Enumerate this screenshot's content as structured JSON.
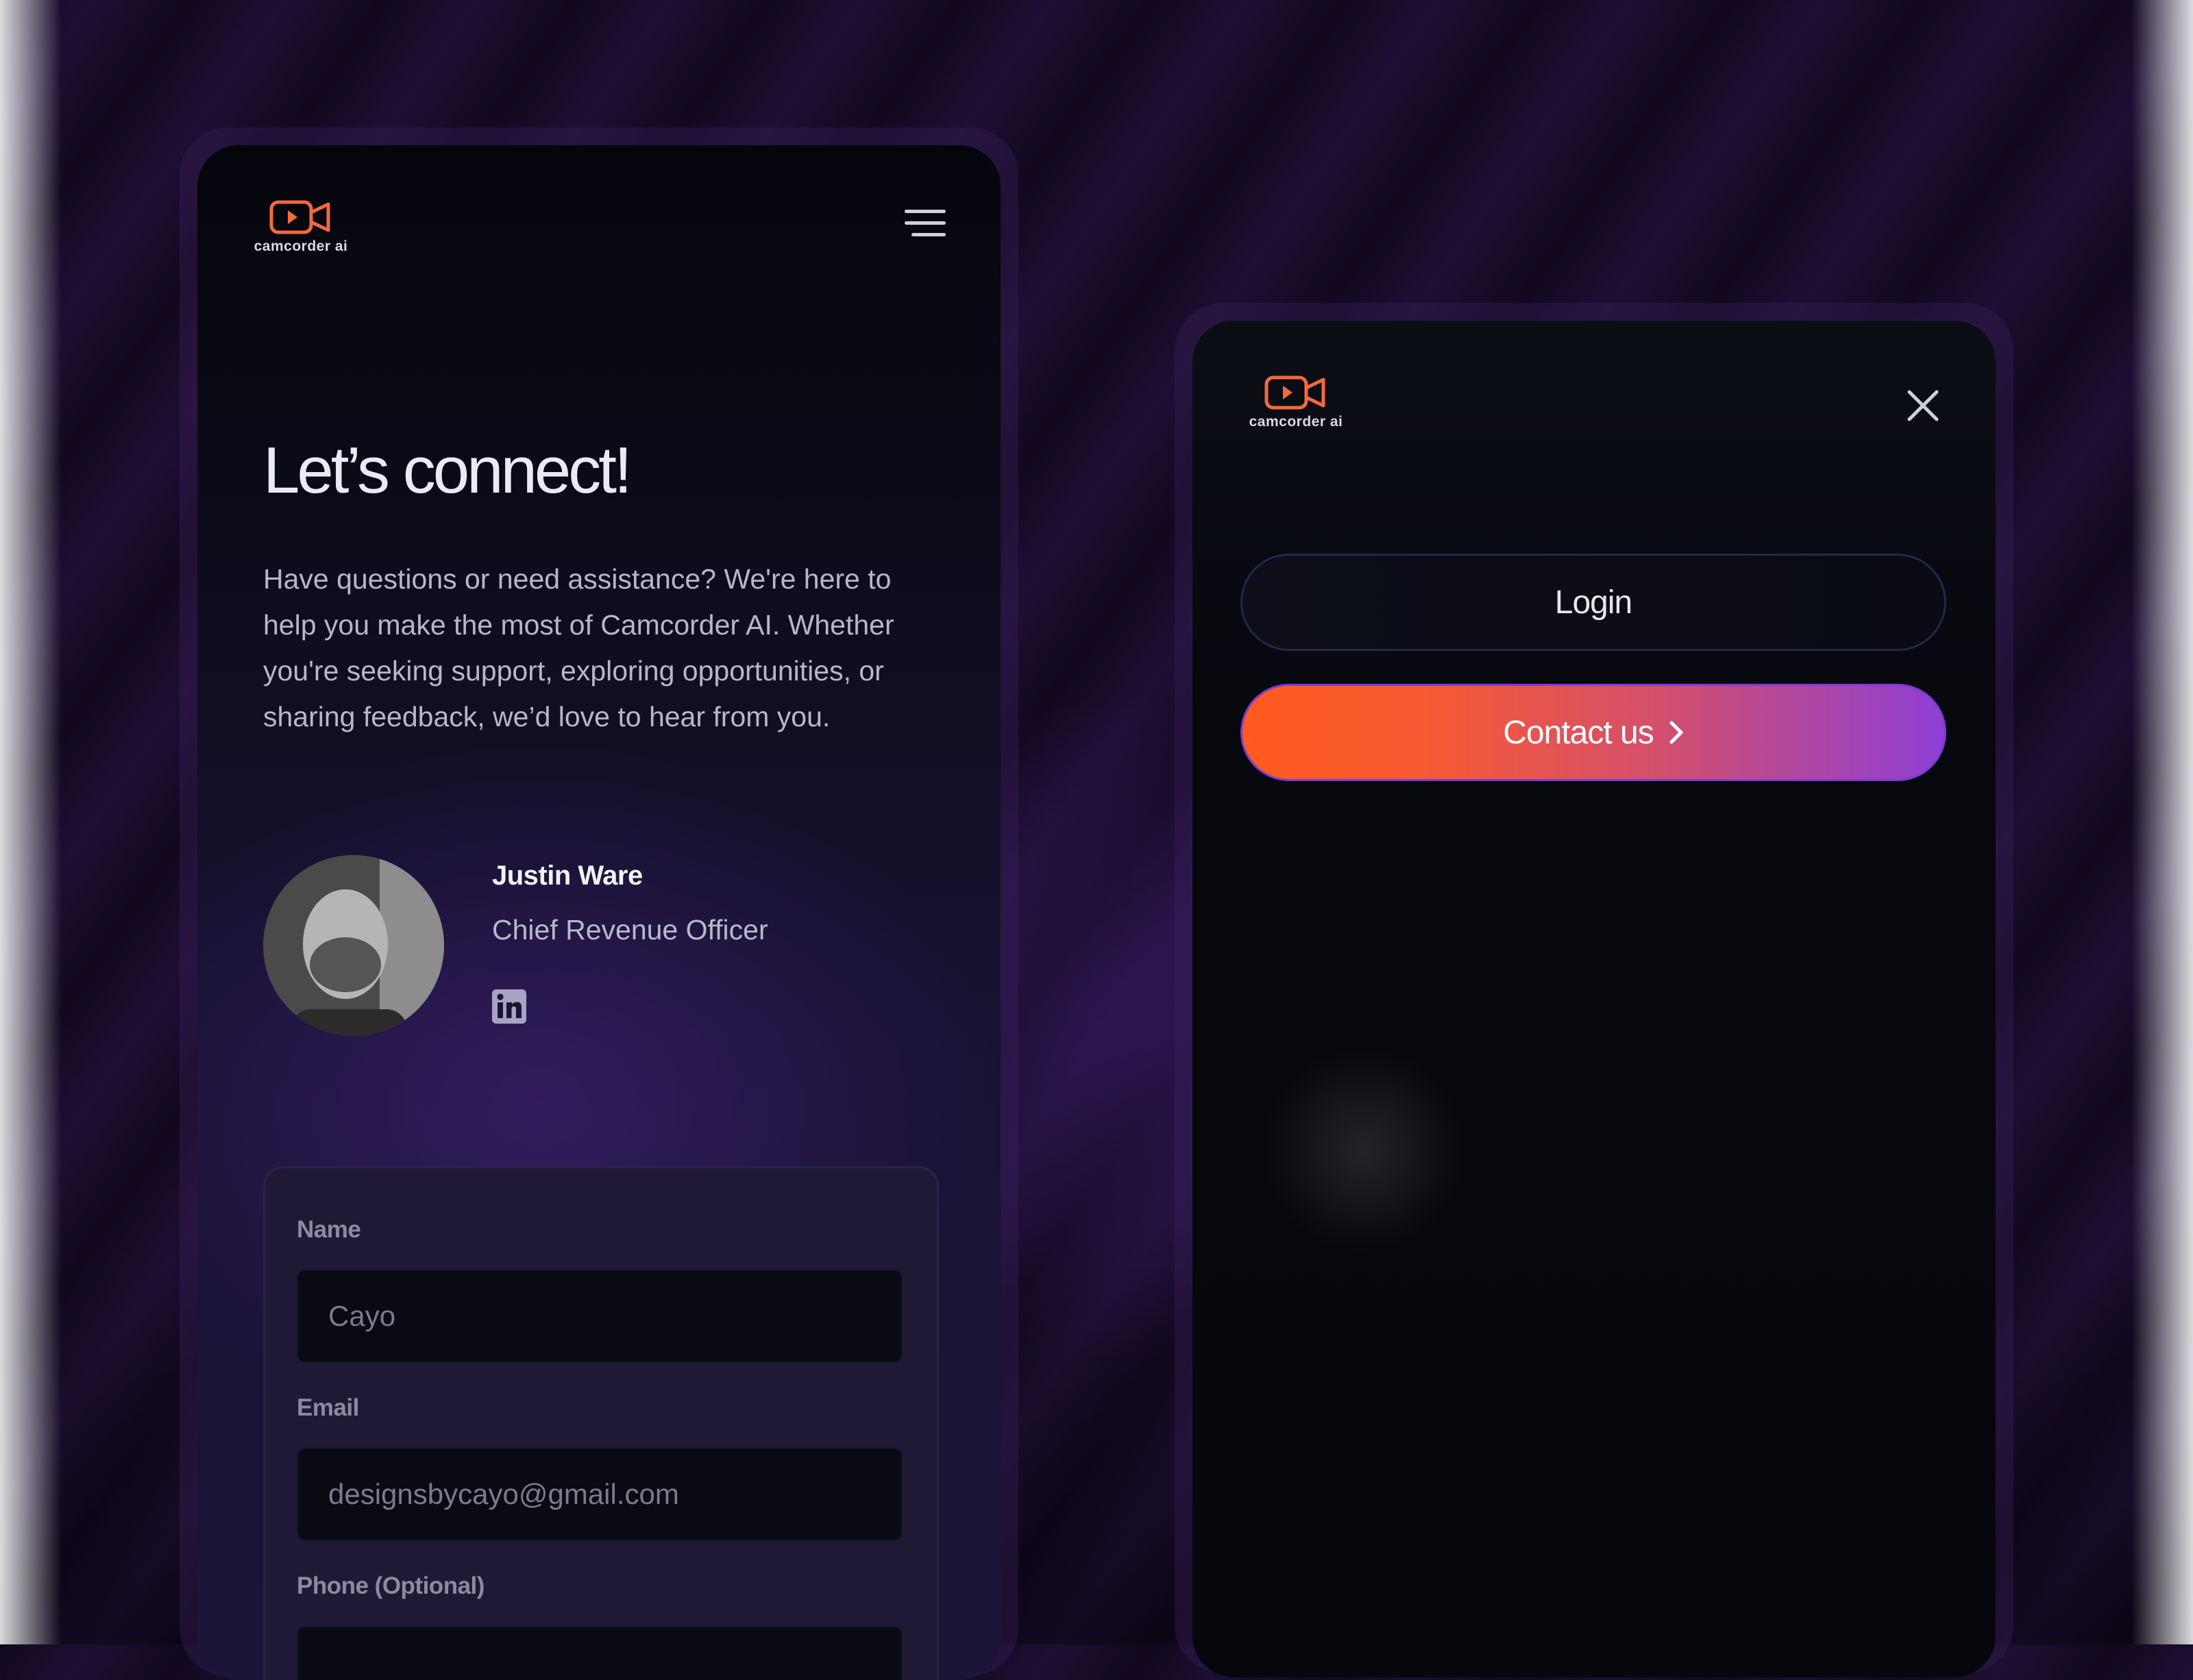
{
  "brand": {
    "name": "camcorder ai",
    "accent_color": "#f26a3d"
  },
  "left_screen": {
    "headline": "Let’s connect!",
    "intro": "Have questions or need assistance? We're here to help you make the most of Camcorder AI. Whether you're seeking support, exploring opportunities, or sharing feedback, we’d love to hear from you.",
    "contact_person": {
      "name": "Justin Ware",
      "role": "Chief Revenue Officer",
      "social_icon": "linkedin-icon"
    },
    "form": {
      "name_label": "Name",
      "name_value": "Cayo",
      "email_label": "Email",
      "email_value": "designsbycayo@gmail.com",
      "phone_label": "Phone (Optional)"
    }
  },
  "right_screen": {
    "login_label": "Login",
    "contact_label": "Contact us"
  }
}
